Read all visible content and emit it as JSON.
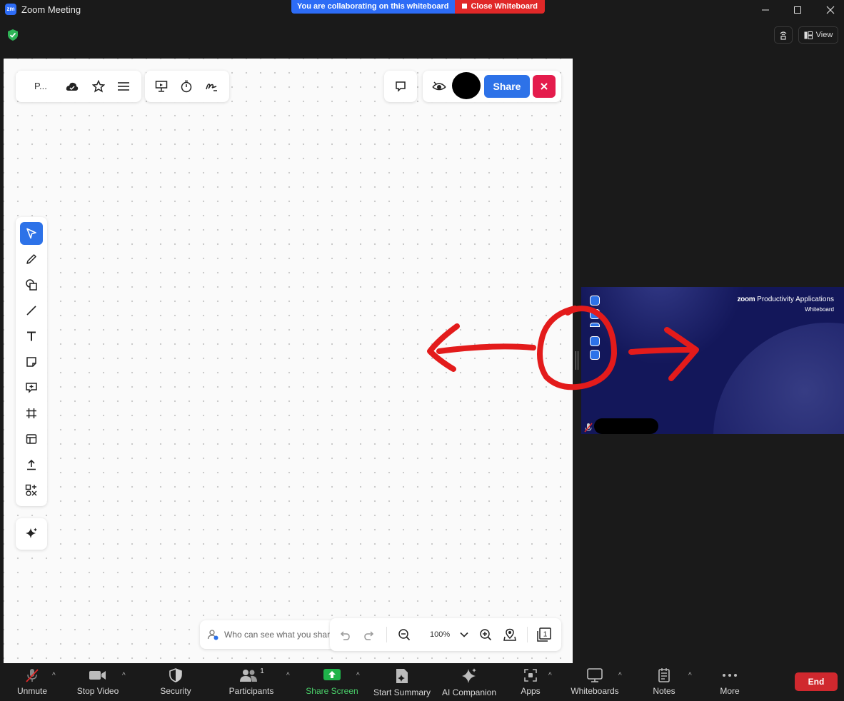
{
  "window": {
    "title": "Zoom Meeting",
    "logo_text": "zm",
    "controls": [
      "minimize-icon",
      "maximize-icon",
      "close-icon"
    ]
  },
  "banner": {
    "collab_text": "You are collaborating on this whiteboard",
    "close_label": "Close Whiteboard"
  },
  "meeting_controls": {
    "view_label": "View"
  },
  "whiteboard": {
    "file_name": "P...",
    "top_left_icons": [
      "cloud-save-icon",
      "star-icon",
      "menu-icon"
    ],
    "present_icons": [
      "presentation-icon",
      "timer-icon",
      "signature-icon"
    ],
    "share_label": "Share",
    "tools": [
      "select",
      "pen",
      "shapes",
      "line",
      "text",
      "sticky-note",
      "comment",
      "frame",
      "template",
      "upload",
      "more-tools"
    ],
    "who_can_see": "Who can see what you shar",
    "zoom_level": "100%",
    "page_count": "1"
  },
  "video_tile": {
    "brand": "zoom",
    "title": "Productivity Applications",
    "subtitle": "Whiteboard"
  },
  "toolbar": {
    "unmute": "Unmute",
    "stop_video": "Stop Video",
    "security": "Security",
    "participants": "Participants",
    "participants_count": "1",
    "share_screen": "Share Screen",
    "start_summary": "Start Summary",
    "ai_companion": "AI Companion",
    "apps": "Apps",
    "whiteboards": "Whiteboards",
    "notes": "Notes",
    "more": "More",
    "end": "End"
  },
  "colors": {
    "accent": "#2d72e8",
    "danger": "#e02828",
    "annotation": "#e31b1b",
    "green": "#4ad06a"
  }
}
